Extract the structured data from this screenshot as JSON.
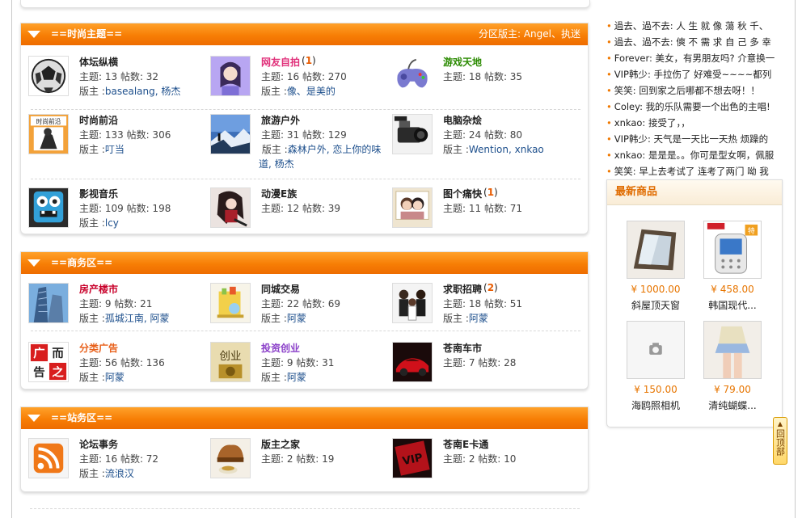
{
  "sections": [
    {
      "title": "==时尚主题==",
      "moderators": "分区版主: Angel、执迷",
      "forums": [
        {
          "name": "体坛纵横",
          "stats": "主题: 13 帖数: 32",
          "mod_prefix": "版主 :",
          "mods": "basealang, 杨杰",
          "name_color": "#222222"
        },
        {
          "name": "网友自拍",
          "new_count": "1",
          "stats": "主题: 16 帖数: 270",
          "mod_prefix": "版主 :",
          "mods": "像、是美的",
          "name_color": "#e0307a"
        },
        {
          "name": "游戏天地",
          "stats": "主题: 18 帖数: 35",
          "name_color": "#2a8a00"
        },
        {
          "name": "时尚前沿",
          "stats": "主题: 133 帖数: 306",
          "mod_prefix": "版主 :",
          "mods": "叮当",
          "name_color": "#222222"
        },
        {
          "name": "旅游户外",
          "stats": "主题: 31 帖数: 129",
          "mod_prefix": "版主 :",
          "mods": "森林户外, 恋上你的味道, 杨杰",
          "name_color": "#222222"
        },
        {
          "name": "电脑杂烩",
          "stats": "主题: 24 帖数: 80",
          "mod_prefix": "版主 :",
          "mods": "Wention, xnkao",
          "name_color": "#222222"
        },
        {
          "name": "影视音乐",
          "stats": "主题: 109 帖数: 198",
          "mod_prefix": "版主 :",
          "mods": "lcy",
          "name_color": "#222222"
        },
        {
          "name": "动漫E族",
          "stats": "主题: 12 帖数: 39",
          "name_color": "#222222"
        },
        {
          "name": "图个痛快",
          "new_count": "1",
          "stats": "主题: 11 帖数: 71",
          "name_color": "#222222"
        }
      ]
    },
    {
      "title": "==商务区==",
      "forums": [
        {
          "name": "房产楼市",
          "stats": "主题: 9 帖数: 21",
          "mod_prefix": "版主 :",
          "mods": "孤城江南, 阿蒙",
          "name_color": "#c8002a"
        },
        {
          "name": "同城交易",
          "stats": "主题: 22 帖数: 69",
          "mod_prefix": "版主 :",
          "mods": "阿蒙",
          "name_color": "#222222"
        },
        {
          "name": "求职招聘",
          "new_count": "2",
          "stats": "主题: 18 帖数: 51",
          "mod_prefix": "版主 :",
          "mods": "阿蒙",
          "name_color": "#222222"
        },
        {
          "name": "分类广告",
          "stats": "主题: 56 帖数: 136",
          "mod_prefix": "版主 :",
          "mods": "阿蒙",
          "name_color": "#e8601a"
        },
        {
          "name": "投资创业",
          "stats": "主题: 9 帖数: 31",
          "mod_prefix": "版主 :",
          "mods": "阿蒙",
          "name_color": "#8a3fc8"
        },
        {
          "name": "苍南车市",
          "stats": "主题: 7 帖数: 28",
          "name_color": "#222222"
        }
      ]
    },
    {
      "title": "==站务区==",
      "forums": [
        {
          "name": "论坛事务",
          "stats": "主题: 16 帖数: 72",
          "mod_prefix": "版主 :",
          "mods": "流浪汉",
          "name_color": "#222222"
        },
        {
          "name": "版主之家",
          "stats": "主题: 2 帖数: 19",
          "name_color": "#222222"
        },
        {
          "name": "苍南E卡通",
          "stats": "主题: 2 帖数: 10",
          "name_color": "#222222"
        }
      ]
    }
  ],
  "news": [
    "過去、過不去: 人 生 就 像 蕩 秋 千、",
    "過去、過不去: 傸 不 需 求 自 己 多 幸",
    "Forever: 美女，有男朋友吗? 介意换一",
    "VIP韩少: 手拉伤了 好难受~~~~都列",
    "笑笑: 回到家之后哪都不想去呀！！",
    "Coley: 我的乐队需要一个出色的主唱!",
    "xnkao: 接受了，，",
    "VIP韩少: 天气是一天比一天热 烦躁的",
    "xnkao: 是是是。。你可是型女啊，佩服",
    "笑笑: 早上去考试了 连考了两门 呦 我"
  ],
  "news_bullet": "•",
  "goods": {
    "title": "最新商品",
    "items": [
      {
        "price": "¥ 1000.00",
        "name": "斜屋顶天窗"
      },
      {
        "price": "¥ 458.00",
        "name": "韩国现代..."
      },
      {
        "price": "¥ 150.00",
        "name": "海鸥照相机"
      },
      {
        "price": "¥ 79.00",
        "name": "清纯蝴蝶..."
      }
    ]
  },
  "back_to_top": "回顶部",
  "back_to_top_arrow": "▲",
  "icon_labels": {
    "fashion": "时尚前沿",
    "ad_tl": "广",
    "ad_tr": "而",
    "ad_bl": "告",
    "ad_br": "之",
    "startup": "创业",
    "vip": "VIP",
    "hot_badge": "特"
  },
  "colors": {
    "header_orange": "#f77e05",
    "price_orange": "#e77500",
    "link_blue": "#1d4f8c"
  }
}
